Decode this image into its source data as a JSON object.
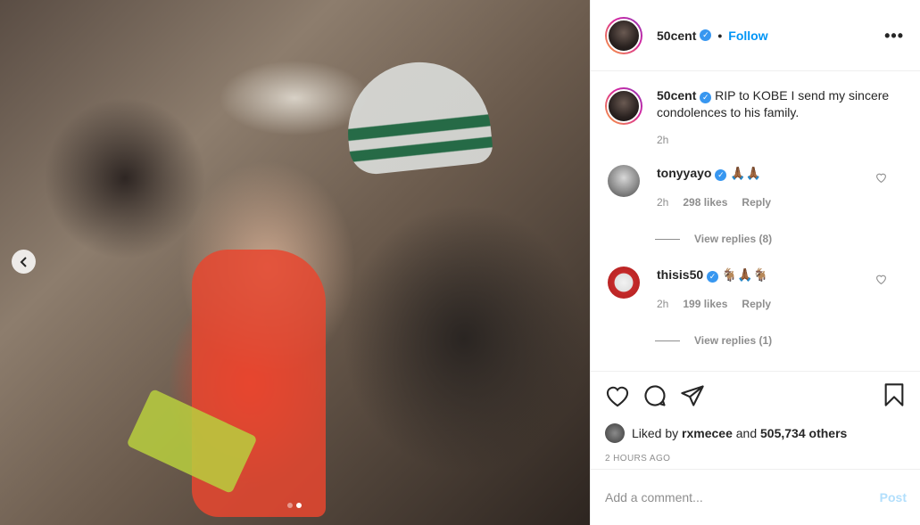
{
  "post": {
    "image_alt": "",
    "carousel": {
      "total": 2,
      "active": 2
    }
  },
  "header": {
    "username": "50cent",
    "separator": "•",
    "follow_label": "Follow",
    "more_label": "•••"
  },
  "caption": {
    "username": "50cent",
    "text": "RIP to KOBE I send my sincere condolences to his family.",
    "time": "2h"
  },
  "comments": [
    {
      "username": "tonyyayo",
      "text": "🙏🏾🙏🏾",
      "time": "2h",
      "likes": "298 likes",
      "reply_label": "Reply",
      "view_replies": "View replies (8)"
    },
    {
      "username": "thisis50",
      "text": "🐐🙏🏾🐐",
      "time": "2h",
      "likes": "199 likes",
      "reply_label": "Reply",
      "view_replies": "View replies (1)"
    }
  ],
  "likes": {
    "prefix": "Liked by",
    "user": "rxmecee",
    "connector": "and",
    "others": "505,734 others"
  },
  "timestamp": "2 HOURS AGO",
  "add_comment": {
    "placeholder": "Add a comment...",
    "post_label": "Post"
  },
  "colors": {
    "link_blue": "#0095f6",
    "verified_blue": "#3897f0",
    "muted": "#8e8e8e",
    "post_disabled": "#b2dffc"
  },
  "icons": [
    "chevron-left-icon",
    "verified-icon",
    "more-icon",
    "heart-icon",
    "comment-icon",
    "share-icon",
    "bookmark-icon"
  ]
}
